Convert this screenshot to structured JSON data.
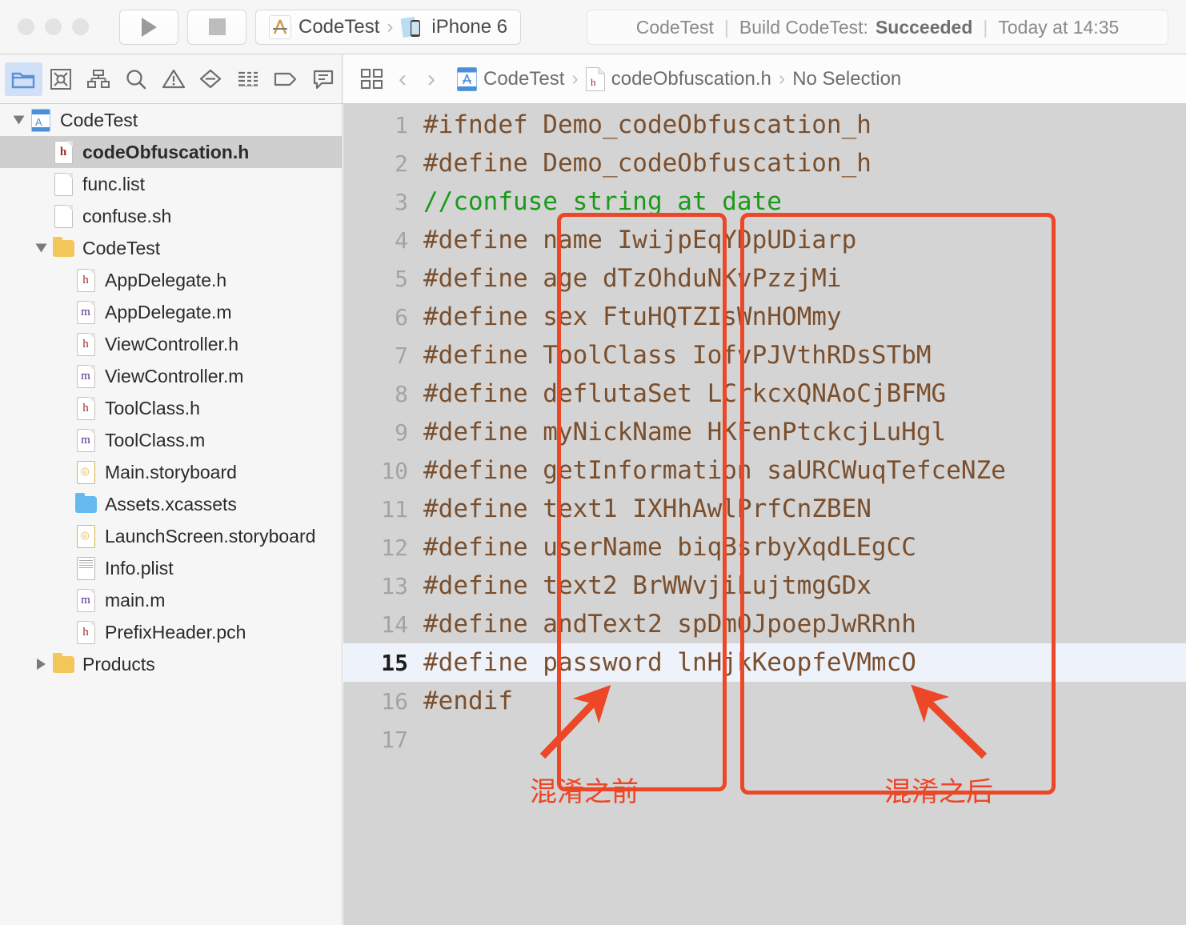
{
  "toolbar": {
    "run_label": "Run",
    "stop_label": "Stop",
    "scheme_project": "CodeTest",
    "scheme_separator": "›",
    "scheme_device": "iPhone 6"
  },
  "status_bar": {
    "project": "CodeTest",
    "divider": "|",
    "build_prefix": "Build CodeTest:",
    "build_result": "Succeeded",
    "timestamp": "Today at 14:35"
  },
  "navigator_icons": [
    {
      "name": "folder-icon",
      "label": "Project navigator",
      "active": true
    },
    {
      "name": "source-control-icon",
      "label": "Source control navigator",
      "active": false
    },
    {
      "name": "hierarchy-icon",
      "label": "Symbol navigator",
      "active": false
    },
    {
      "name": "search-icon",
      "label": "Find navigator",
      "active": false
    },
    {
      "name": "warning-triangle-icon",
      "label": "Issue navigator",
      "active": false
    },
    {
      "name": "test-diamond-icon",
      "label": "Test navigator",
      "active": false
    },
    {
      "name": "report-lines-icon",
      "label": "Report navigator",
      "active": false
    },
    {
      "name": "tag-icon",
      "label": "Breakpoint navigator",
      "active": false
    },
    {
      "name": "comment-bubble-icon",
      "label": "Debug navigator",
      "active": false
    }
  ],
  "editor_bar": {
    "jump_bar_icon": "grid-icon",
    "back_chevron": "‹",
    "forward_chevron": "›",
    "crumb_separator": "›",
    "breadcrumbs": [
      {
        "icon": "project-icon",
        "label": "CodeTest"
      },
      {
        "icon": "header-file-icon",
        "label": "codeObfuscation.h"
      },
      {
        "icon": "",
        "label": "No Selection"
      }
    ]
  },
  "sidebar": {
    "items": [
      {
        "label": "CodeTest",
        "indent": 0,
        "twisty": "open",
        "icon": "project-icon",
        "selected": false
      },
      {
        "label": "codeObfuscation.h",
        "indent": 1,
        "twisty": "none",
        "icon": "header-file-icon",
        "selected": true
      },
      {
        "label": "func.list",
        "indent": 1,
        "twisty": "none",
        "icon": "plain-file-icon",
        "selected": false
      },
      {
        "label": "confuse.sh",
        "indent": 1,
        "twisty": "none",
        "icon": "plain-file-icon",
        "selected": false
      },
      {
        "label": "CodeTest",
        "indent": 1,
        "twisty": "open",
        "icon": "folder-icon",
        "selected": false
      },
      {
        "label": "AppDelegate.h",
        "indent": 2,
        "twisty": "none",
        "icon": "header-file-icon",
        "selected": false
      },
      {
        "label": "AppDelegate.m",
        "indent": 2,
        "twisty": "none",
        "icon": "implementation-file-icon",
        "selected": false
      },
      {
        "label": "ViewController.h",
        "indent": 2,
        "twisty": "none",
        "icon": "header-file-icon",
        "selected": false
      },
      {
        "label": "ViewController.m",
        "indent": 2,
        "twisty": "none",
        "icon": "implementation-file-icon",
        "selected": false
      },
      {
        "label": "ToolClass.h",
        "indent": 2,
        "twisty": "none",
        "icon": "header-file-icon",
        "selected": false
      },
      {
        "label": "ToolClass.m",
        "indent": 2,
        "twisty": "none",
        "icon": "implementation-file-icon",
        "selected": false
      },
      {
        "label": "Main.storyboard",
        "indent": 2,
        "twisty": "none",
        "icon": "storyboard-icon",
        "selected": false
      },
      {
        "label": "Assets.xcassets",
        "indent": 2,
        "twisty": "none",
        "icon": "assets-folder-icon",
        "selected": false
      },
      {
        "label": "LaunchScreen.storyboard",
        "indent": 2,
        "twisty": "none",
        "icon": "storyboard-icon",
        "selected": false
      },
      {
        "label": "Info.plist",
        "indent": 2,
        "twisty": "none",
        "icon": "plist-icon",
        "selected": false
      },
      {
        "label": "main.m",
        "indent": 2,
        "twisty": "none",
        "icon": "implementation-file-icon",
        "selected": false
      },
      {
        "label": "PrefixHeader.pch",
        "indent": 2,
        "twisty": "none",
        "icon": "header-file-icon",
        "selected": false
      },
      {
        "label": "Products",
        "indent": 1,
        "twisty": "closed",
        "icon": "folder-icon",
        "selected": false
      }
    ]
  },
  "code": {
    "language": "objective-c-header",
    "current_line": 15,
    "lines": [
      {
        "n": "1",
        "text": "#ifndef Demo_codeObfuscation_h",
        "kind": "code"
      },
      {
        "n": "2",
        "text": "#define Demo_codeObfuscation_h",
        "kind": "code"
      },
      {
        "n": "3",
        "text": "//confuse string at date",
        "kind": "comment"
      },
      {
        "n": "4",
        "text": "#define name IwijpEqYDpUDiarp",
        "kind": "code"
      },
      {
        "n": "5",
        "text": "#define age dTzOhduNKvPzzjMi",
        "kind": "code"
      },
      {
        "n": "6",
        "text": "#define sex FtuHQTZIsWnHOMmy",
        "kind": "code"
      },
      {
        "n": "7",
        "text": "#define ToolClass IofvPJVthRDsSTbM",
        "kind": "code"
      },
      {
        "n": "8",
        "text": "#define deflutaSet LCrkcxQNAoCjBFMG",
        "kind": "code"
      },
      {
        "n": "9",
        "text": "#define myNickName HKFenPtckcjLuHgl",
        "kind": "code"
      },
      {
        "n": "10",
        "text": "#define getInformation saURCWuqTefceNZe",
        "kind": "code"
      },
      {
        "n": "11",
        "text": "#define text1 IXHhAwlPrfCnZBEN",
        "kind": "code"
      },
      {
        "n": "12",
        "text": "#define userName biqBsrbyXqdLEgCC",
        "kind": "code"
      },
      {
        "n": "13",
        "text": "#define text2 BrWWvjiLujtmgGDx",
        "kind": "code"
      },
      {
        "n": "14",
        "text": "#define andText2 spDmOJpoepJwRRnh",
        "kind": "code"
      },
      {
        "n": "15",
        "text": "#define password lnHjkKeopfeVMmcO",
        "kind": "code"
      },
      {
        "n": "16",
        "text": "#endif",
        "kind": "code"
      },
      {
        "n": "17",
        "text": "",
        "kind": "code"
      }
    ]
  },
  "annotations": {
    "accent_color": "#ec4727",
    "before_label": "混淆之前",
    "after_label": "混淆之后"
  },
  "colors": {
    "editor_background": "#d4d4d4",
    "current_line_background": "#eef2fb",
    "keyword_brown": "#7a4f2d",
    "comment_green": "#1a9a1a",
    "sidebar_background": "#f6f6f6",
    "selection_gray": "#cfcfcf",
    "navigator_active_blue": "#cfe0f7"
  }
}
